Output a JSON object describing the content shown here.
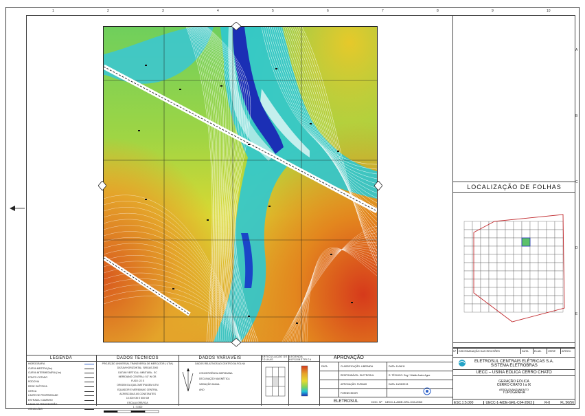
{
  "frame": {
    "top_columns": [
      "1",
      "2",
      "3",
      "4",
      "5",
      "6",
      "7",
      "8",
      "9",
      "10"
    ],
    "right_rows": [
      "A",
      "B",
      "C",
      "D",
      "E"
    ]
  },
  "map": {
    "colors": {
      "low": "#1a2fb8",
      "mid_low": "#22c3d8",
      "mid": "#7fd35a",
      "mid_high": "#e6d930",
      "high": "#e07a1e",
      "peak": "#d23a1c"
    }
  },
  "location_panel": {
    "title": "LOCALIZAÇÃO DE FOLHAS"
  },
  "revision_table": {
    "headers": [
      "Nº",
      "DISCRIMINAÇÃO DAS REVISÕES",
      "DATA",
      "ELAB.",
      "VERIF.",
      "APROV."
    ]
  },
  "legend": {
    "title": "LEGENDA",
    "items": [
      "HIDROGRAFIA",
      "CURVA MESTRA (5m)",
      "CURVA INTERMEDIÁRIA (1m)",
      "PONTO COTADO",
      "RODOVIA",
      "REDE ELÉTRICA",
      "CERCA",
      "LIMITE DE PROPRIEDADE",
      "ESTRADA / CAMINHO",
      "LINHA DE TRANSMISSÃO",
      "CONCLUÍDO"
    ]
  },
  "technical": {
    "title": "DADOS TÉCNICOS",
    "lines": [
      "PROJEÇÃO UNIVERSAL TRANSVERSA DE MERCATOR ( UTM )",
      "DATUM HORIZONTAL: SIRGAS 2000",
      "DATUM VERTICAL: IMBITUBA - SC",
      "MERIDIANO CENTRAL: 51° W GR.",
      "FUSO: 22 S",
      "ORIGEM DA QUILOMETRAGEM UTM",
      "EQUADOR E MERIDIANO CENTRAL",
      "ACRESCIDAS AS CONSTANTES",
      "10.000 KM E 500 KM",
      "ESCALA GRÁFICA",
      "1 : 5.000"
    ]
  },
  "variables": {
    "title": "DADOS VARIÁVEIS",
    "subtitle": "DADOS RELATIVOS AO CENTRO DA FOLHA",
    "lines": [
      "CONVERGÊNCIA MERIDIANA",
      "DECLINAÇÃO MAGNÉTICA",
      "VARIAÇÃO ANUAL",
      "ANO"
    ]
  },
  "articulation": {
    "title": "ARTICULAÇÃO DE FOLHAS"
  },
  "hypsometry": {
    "title": "LEGENDA HIPSOMÉTRICA"
  },
  "approval": {
    "title": "APROVAÇÃO",
    "rows": [
      [
        "DATA",
        "CLASSIFICAÇÃO: LIBERADA",
        "DATA: 11/06/11"
      ],
      [
        "",
        "RESPONSÁVEL: ELETROSUL",
        "R. TÉCNICO: Eng.º Waldir Andre Agne"
      ],
      [
        "",
        "APROVAÇÃO: FURNAS",
        "DATA: 16/05/2013"
      ],
      [
        "",
        "FORNECEDOR",
        ""
      ]
    ],
    "company": "ELETROSUL",
    "doc_label": "DOC. Nº",
    "doc_number": "UECC-1-AIDE-GRL-C04-2063"
  },
  "title_block": {
    "company_line1": "ELETROSUL CENTRAIS ELÉTRICAS S.A.",
    "company_line2": "SISTEMA ELETROBRAS",
    "project": "UECC – USINA EÓLICA CERRO CHATO",
    "line1": "GERAÇÃO EÓLICA",
    "line2": "CERRO CHATO I a IX",
    "line3": "AEROLEVANTAMENTO",
    "line4": "TOPOGRAFIA",
    "scale": "ESC.1:5.000",
    "drawing_number": "UECC-1-AIDE-GRL-C04-2063",
    "revision": "R-0",
    "sheet": "FL.56/56"
  }
}
